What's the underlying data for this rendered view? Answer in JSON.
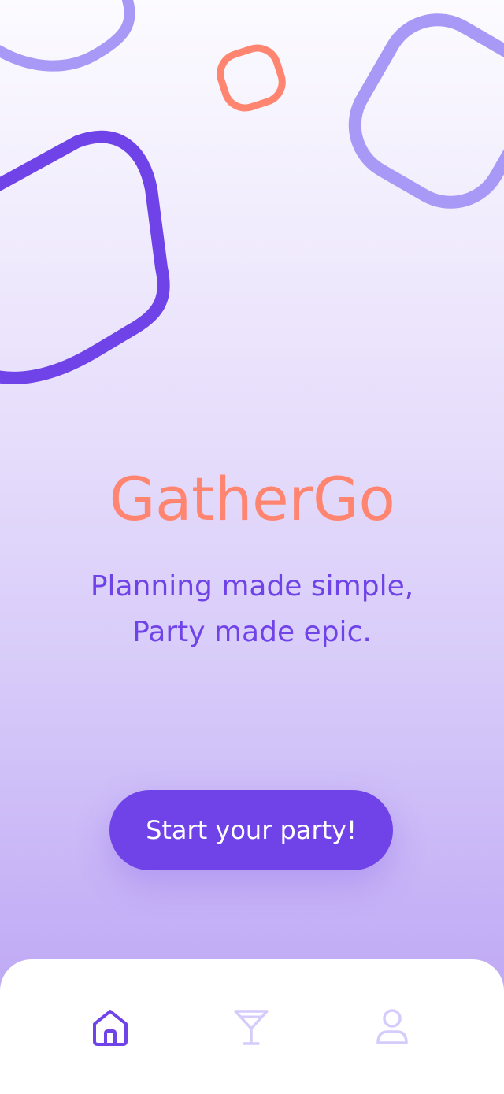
{
  "app": {
    "title": "GatherGo",
    "tagline_lines": [
      "Planning made simple,",
      "Party made epic."
    ]
  },
  "cta": {
    "label": "Start your party!"
  },
  "bottom_nav": {
    "items": [
      {
        "icon": "home-icon",
        "active": true
      },
      {
        "icon": "cocktail-icon",
        "active": false
      },
      {
        "icon": "profile-icon",
        "active": false
      }
    ]
  },
  "colors": {
    "brand_coral": "#ff8570",
    "brand_purple": "#6f43e8",
    "shape_lavender": "#a999f7",
    "inactive_icon": "#d6ccfb",
    "nav_background": "#ffffff"
  }
}
